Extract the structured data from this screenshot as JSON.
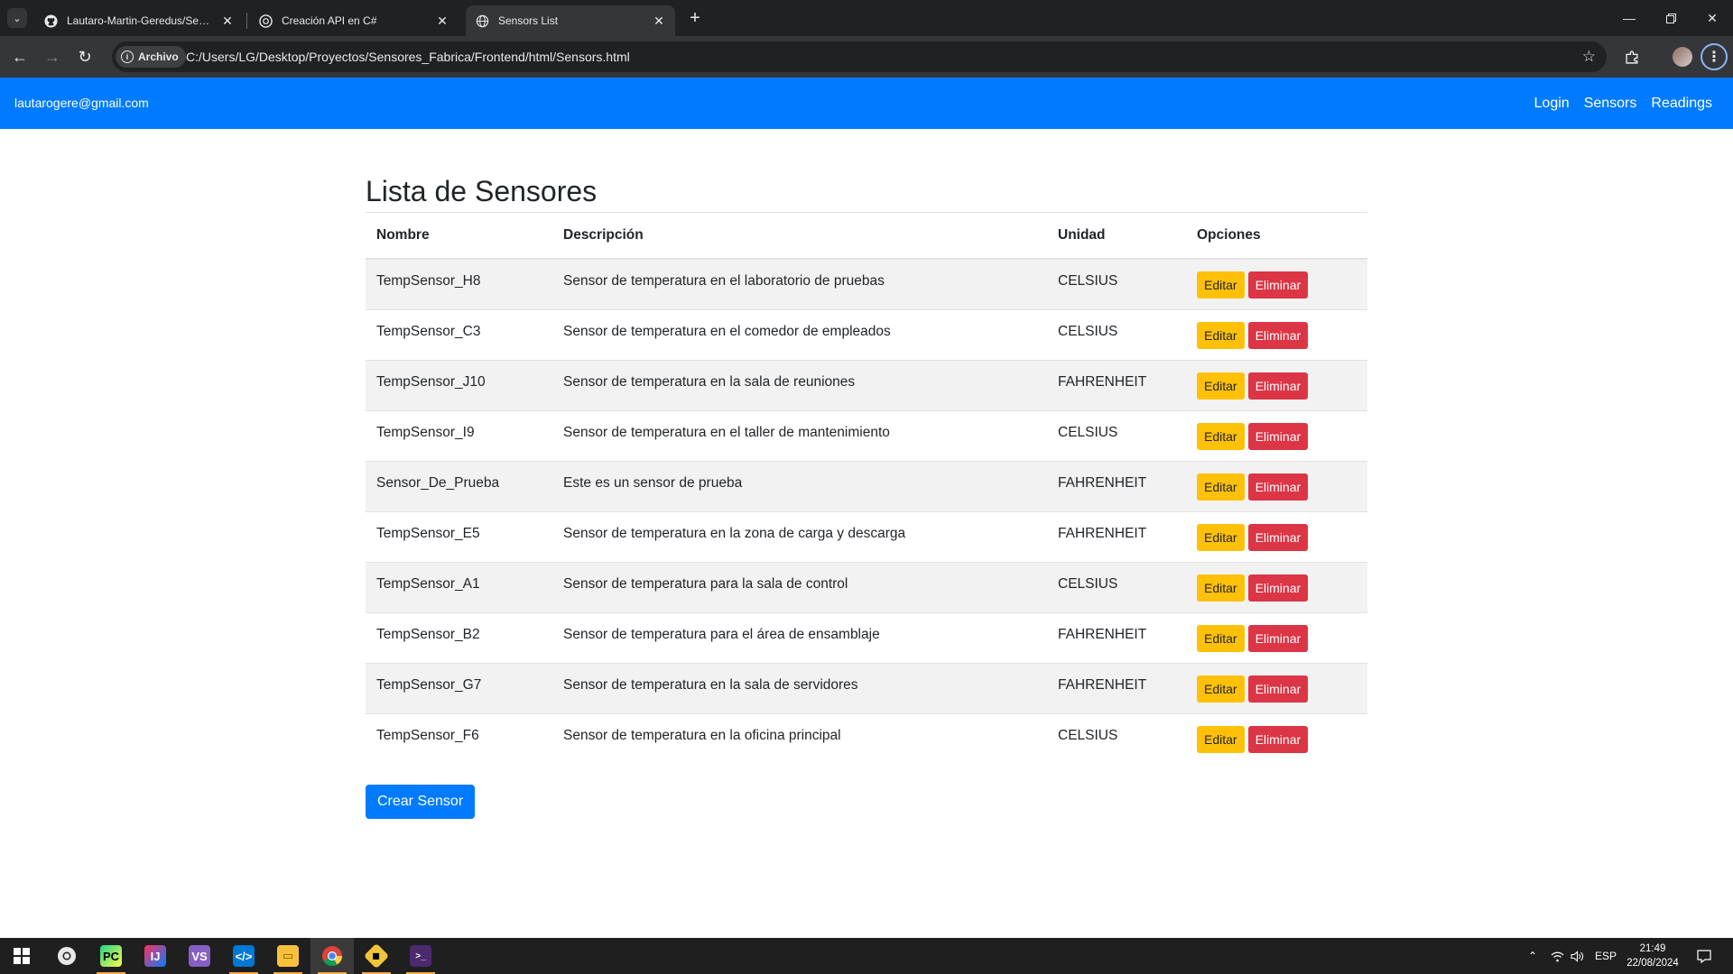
{
  "browser": {
    "tabs": [
      {
        "title": "Lautaro-Martin-Geredus/Sensores_Fabrica",
        "icon": "github-icon",
        "active": false
      },
      {
        "title": "Creación API en C#",
        "icon": "openai-icon",
        "active": false
      },
      {
        "title": "Sensors List",
        "icon": "globe-icon",
        "active": true
      }
    ],
    "site_chip_label": "Archivo",
    "url": "C:/Users/LG/Desktop/Proyectos/Sensores_Fabrica/Frontend/html/Sensors.html"
  },
  "navbar": {
    "email": "lautarogere@gmail.com",
    "links": [
      "Login",
      "Sensors",
      "Readings"
    ],
    "color": "#007bff"
  },
  "page": {
    "title": "Lista de Sensores",
    "columns": [
      "Nombre",
      "Descripción",
      "Unidad",
      "Opciones"
    ],
    "edit_label": "Editar",
    "delete_label": "Eliminar",
    "create_label": "Crear Sensor",
    "rows": [
      {
        "name": "TempSensor_H8",
        "description": "Sensor de temperatura en el laboratorio de pruebas",
        "unit": "CELSIUS"
      },
      {
        "name": "TempSensor_C3",
        "description": "Sensor de temperatura en el comedor de empleados",
        "unit": "CELSIUS"
      },
      {
        "name": "TempSensor_J10",
        "description": "Sensor de temperatura en la sala de reuniones",
        "unit": "FAHRENHEIT"
      },
      {
        "name": "TempSensor_I9",
        "description": "Sensor de temperatura en el taller de mantenimiento",
        "unit": "CELSIUS"
      },
      {
        "name": "Sensor_De_Prueba",
        "description": "Este es un sensor de prueba",
        "unit": "FAHRENHEIT"
      },
      {
        "name": "TempSensor_E5",
        "description": "Sensor de temperatura en la zona de carga y descarga",
        "unit": "FAHRENHEIT"
      },
      {
        "name": "TempSensor_A1",
        "description": "Sensor de temperatura para la sala de control",
        "unit": "CELSIUS"
      },
      {
        "name": "TempSensor_B2",
        "description": "Sensor de temperatura para el área de ensamblaje",
        "unit": "FAHRENHEIT"
      },
      {
        "name": "TempSensor_G7",
        "description": "Sensor de temperatura en la sala de servidores",
        "unit": "FAHRENHEIT"
      },
      {
        "name": "TempSensor_F6",
        "description": "Sensor de temperatura en la oficina principal",
        "unit": "CELSIUS"
      }
    ]
  },
  "taskbar": {
    "apps": [
      "windows-start-icon",
      "chrome-canary-icon",
      "pycharm-icon",
      "intellij-icon",
      "visual-studio-icon",
      "vscode-icon",
      "file-explorer-icon",
      "chrome-icon",
      "git-icon",
      "terminal-icon"
    ],
    "language": "ESP",
    "time": "21:49",
    "date": "22/08/2024"
  }
}
